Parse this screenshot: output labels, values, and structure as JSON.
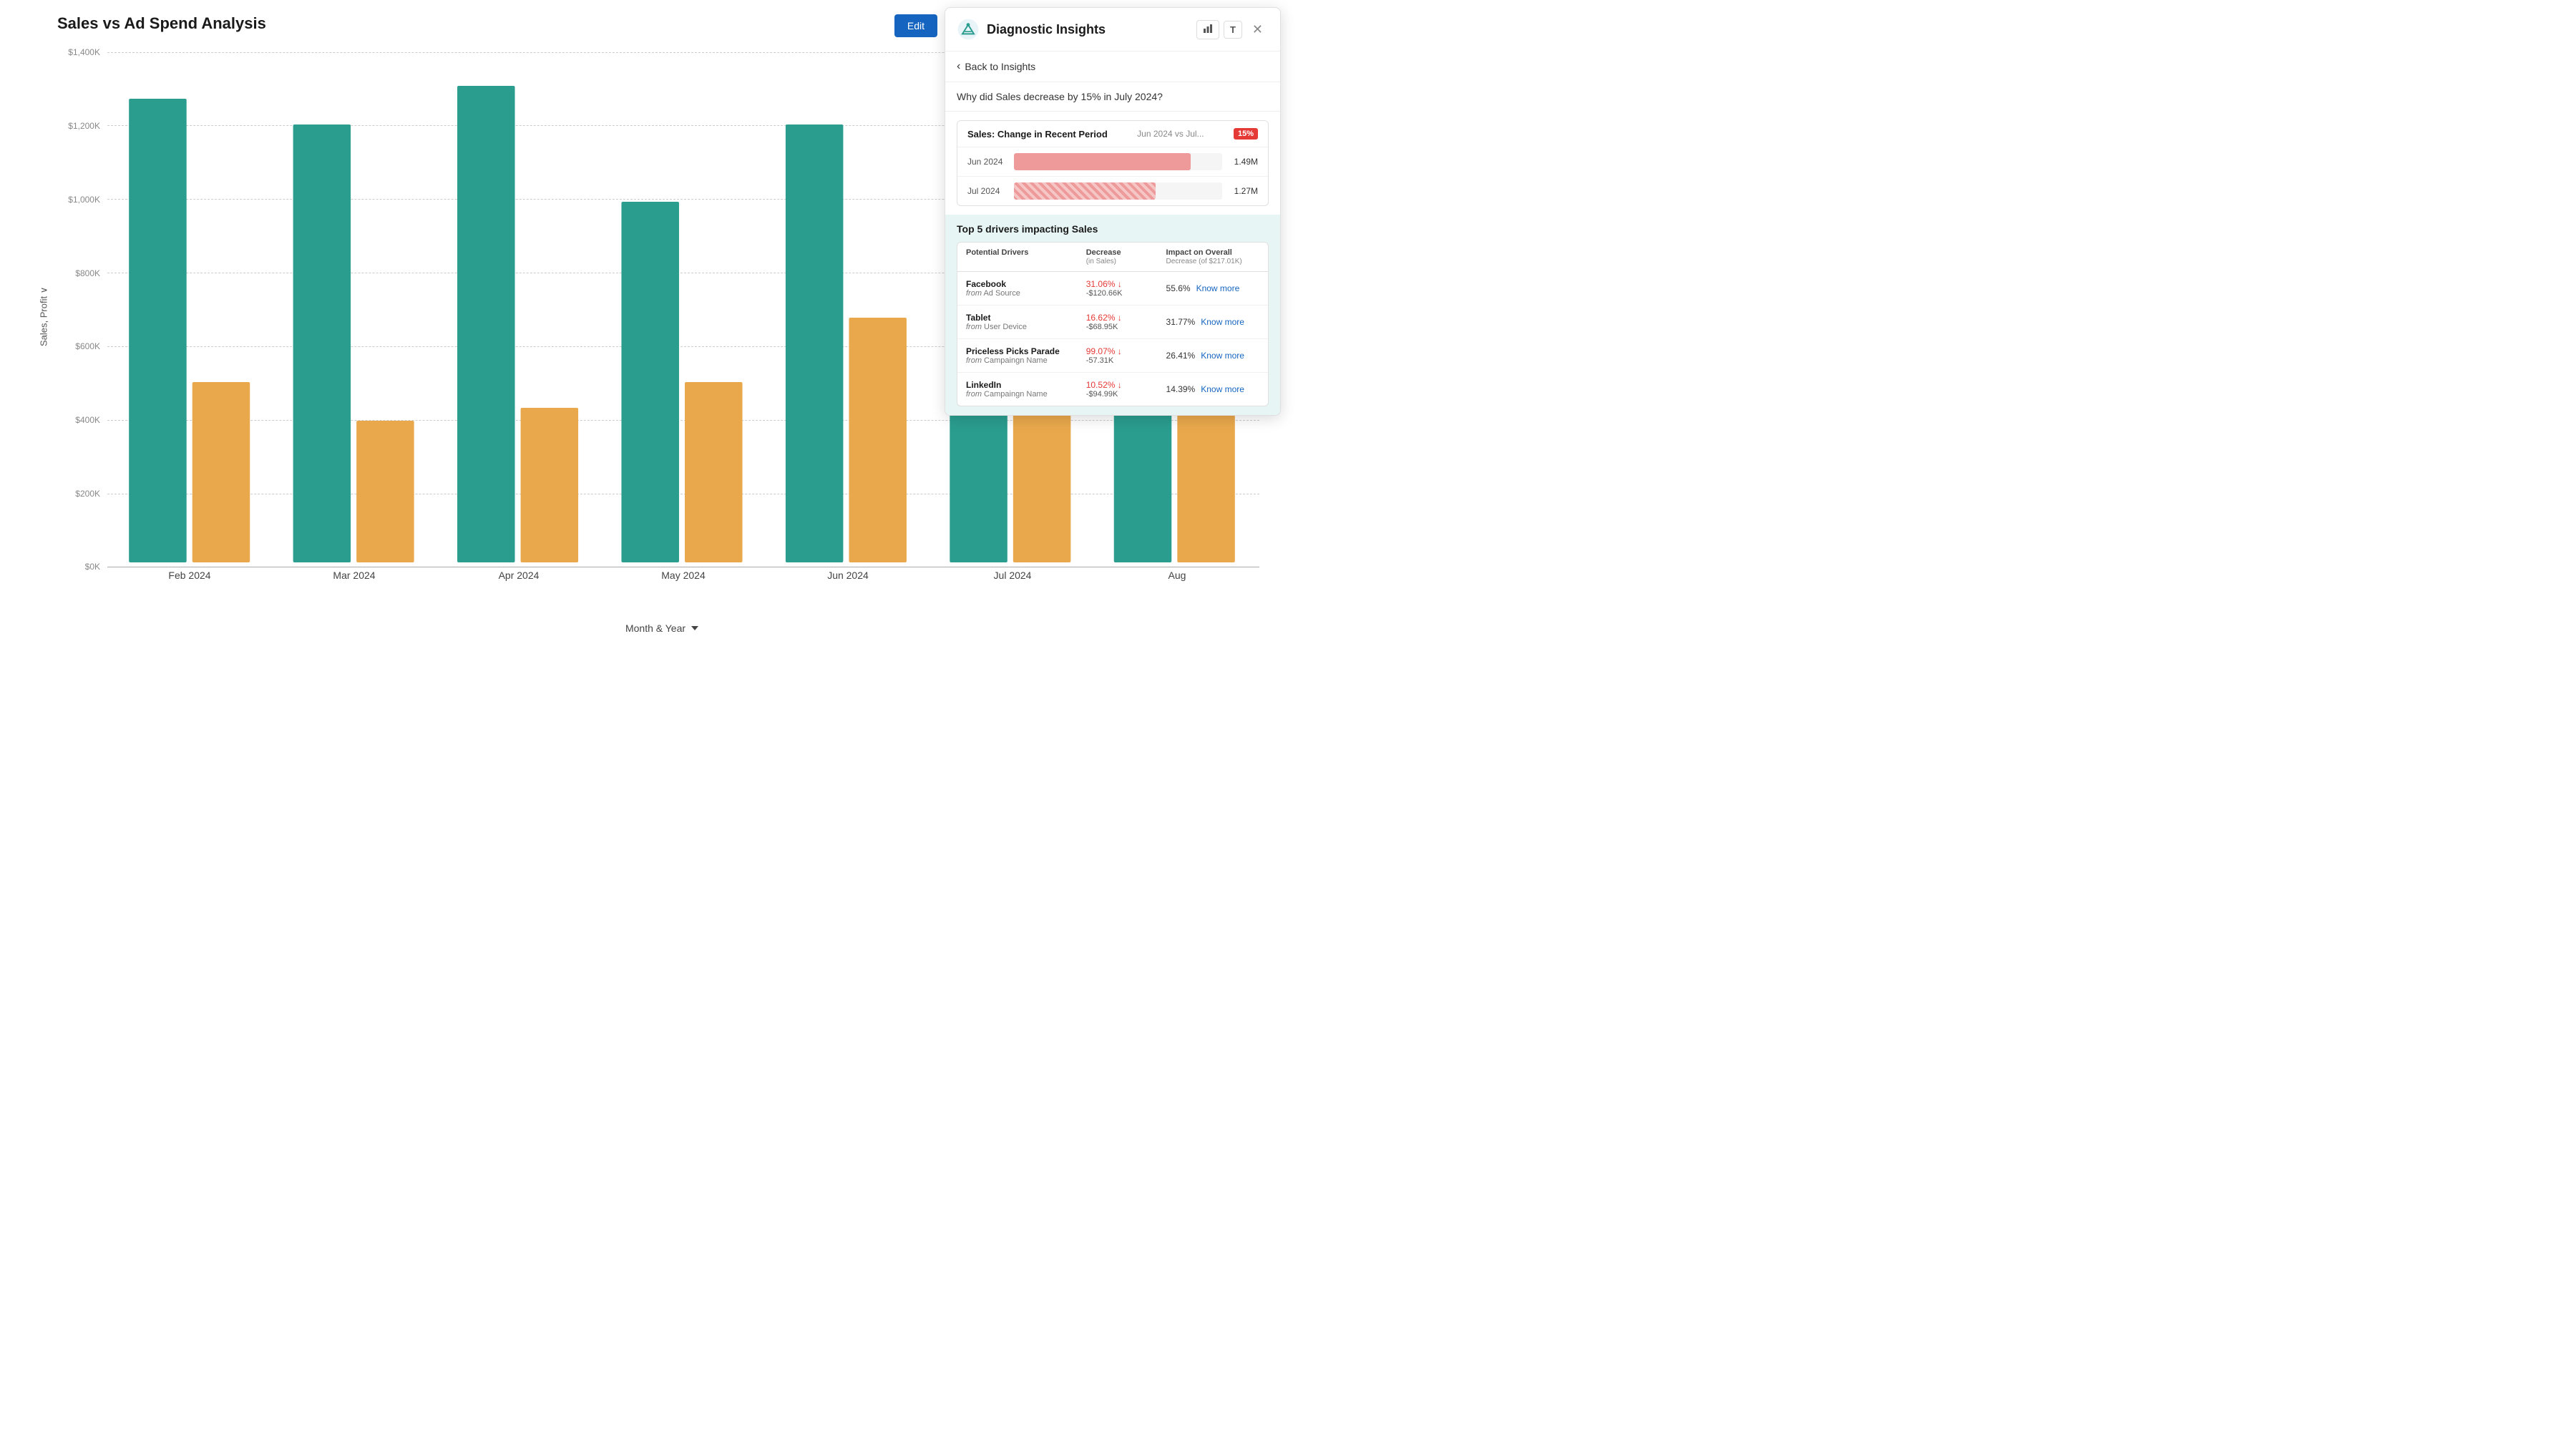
{
  "title": "Sales vs Ad Spend Analysis",
  "chart": {
    "yAxis": {
      "label": "Sales,Profit ∨",
      "ticks": [
        {
          "label": "$1,400K",
          "pct": 100
        },
        {
          "label": "$1,200K",
          "pct": 85.7
        },
        {
          "label": "$1,000K",
          "pct": 71.4
        },
        {
          "label": "$800K",
          "pct": 57.1
        },
        {
          "label": "$600K",
          "pct": 42.9
        },
        {
          "label": "$400K",
          "pct": 28.6
        },
        {
          "label": "$200K",
          "pct": 14.3
        },
        {
          "label": "$0K",
          "pct": 0
        }
      ]
    },
    "xAxisLabel": "Month & Year",
    "bars": [
      {
        "month": "Feb 2024",
        "teal": 90,
        "orange": 35
      },
      {
        "month": "Mar 2024",
        "teal": 86,
        "orange": 27
      },
      {
        "month": "Apr 2024",
        "teal": 93,
        "orange": 29
      },
      {
        "month": "May 2024",
        "teal": 72,
        "orange": 36
      },
      {
        "month": "Jun 2024",
        "teal": 86,
        "orange": 46
      },
      {
        "month": "Jul 2024",
        "teal": 96,
        "orange": 39
      },
      {
        "month": "Aug ...",
        "teal": 94,
        "orange": 43
      }
    ]
  },
  "editButton": "Edit",
  "panel": {
    "title": "Diagnostic Insights",
    "backLabel": "Back to Insights",
    "question": "Why did Sales decrease by 15% in July 2024?",
    "salesCard": {
      "title": "Sales: Change in Recent Period",
      "period": "Jun 2024 vs Jul...",
      "badge": "15%",
      "rows": [
        {
          "label": "Jun 2024",
          "value": "1.49M",
          "fillPct": 85,
          "striped": false
        },
        {
          "label": "Jul 2024",
          "value": "1.27M",
          "fillPct": 68,
          "striped": true
        }
      ]
    },
    "driversTitle": "Top 5 drivers impacting Sales",
    "driversTableHeaders": {
      "col1": "Potential Drivers",
      "col2": "Decrease",
      "col2sub": "(in Sales)",
      "col3": "Impact on Overall",
      "col3sub": "Decrease (of $217.01K)"
    },
    "drivers": [
      {
        "name": "Facebook",
        "from": "Ad Source",
        "pct": "31.06%",
        "amount": "-$120.66K",
        "impact": "55.6%",
        "knowMore": "Know more"
      },
      {
        "name": "Tablet",
        "from": "User Device",
        "pct": "16.62%",
        "amount": "-$68.95K",
        "impact": "31.77%",
        "knowMore": "Know more"
      },
      {
        "name": "Priceless Picks Parade",
        "from": "Campaingn Name",
        "pct": "99.07%",
        "amount": "-57.31K",
        "impact": "26.41%",
        "knowMore": "Know more"
      },
      {
        "name": "LinkedIn",
        "from": "Campaingn Name",
        "pct": "10.52%",
        "amount": "-$94.99K",
        "impact": "14.39%",
        "knowMore": "Know more"
      }
    ]
  }
}
